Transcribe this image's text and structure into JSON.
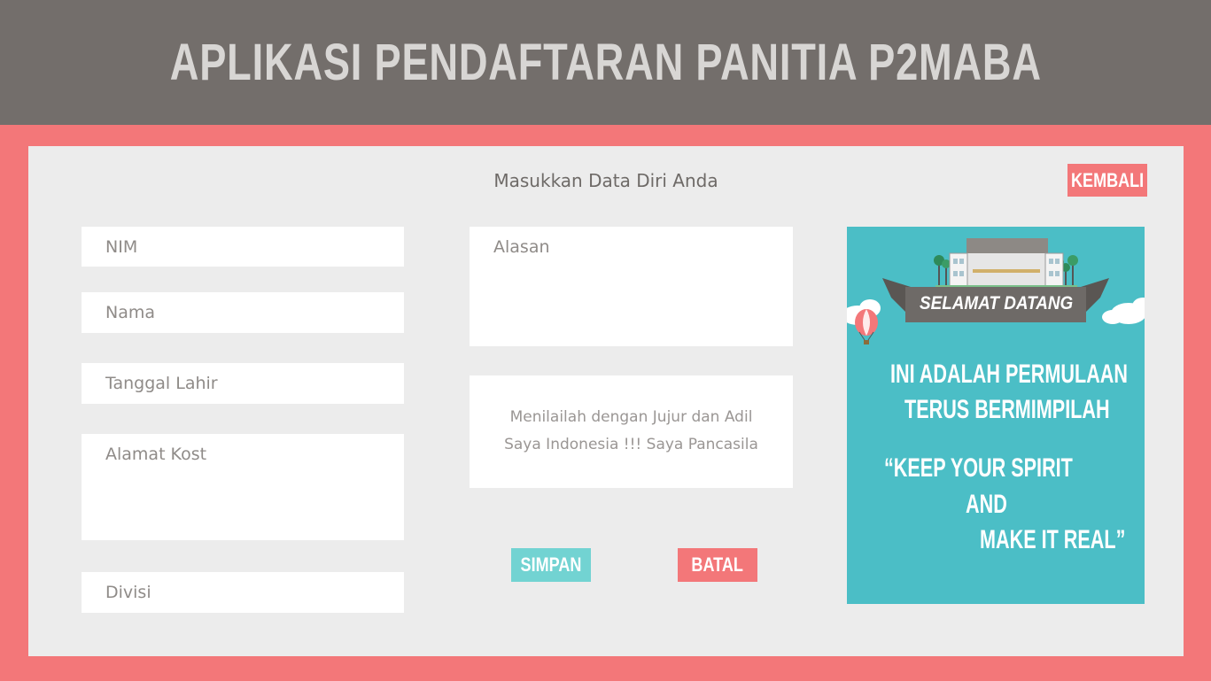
{
  "header": {
    "title": "APLIKASI PENDAFTARAN PANITIA P2MABA"
  },
  "form": {
    "heading": "Masukkan Data Diri Anda",
    "back_label": "KEMBALI",
    "fields": {
      "nim": "NIM",
      "nama": "Nama",
      "tanggal_lahir": "Tanggal Lahir",
      "alamat_kost": "Alamat Kost",
      "divisi": "Divisi",
      "alasan": "Alasan"
    },
    "quote_lines": [
      "Menilailah dengan Jujur dan Adil",
      "Saya Indonesia !!! Saya Pancasila"
    ],
    "save_label": "SIMPAN",
    "cancel_label": "BATAL"
  },
  "poster": {
    "banner": "SELAMAT DATANG",
    "lines": [
      "INI ADALAH PERMULAAN",
      "TERUS BERMIMPILAH",
      "“KEEP YOUR SPIRIT",
      "AND",
      "MAKE IT REAL”"
    ]
  },
  "colors": {
    "header_bg": "#736e6b",
    "frame": "#f37779",
    "panel": "#ececec",
    "save_button": "#72d3d2",
    "cancel_button": "#f37779",
    "poster_bg": "#4bbec6"
  }
}
